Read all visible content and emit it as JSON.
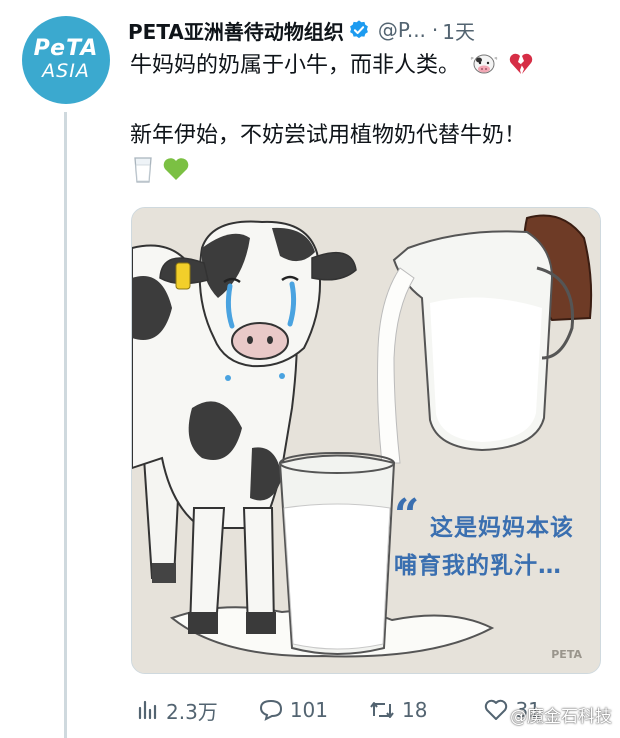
{
  "account": {
    "name": "PETA亚洲善待动物组织",
    "handle": "@P...",
    "separator": "·",
    "time": "1天",
    "avatar_line1": "PeTA",
    "avatar_line2": "ASIA"
  },
  "tweet": {
    "line1": "牛妈妈的奶属于小牛，而非人类。",
    "line2": "新年伊始，不妨尝试用植物奶代替牛奶！"
  },
  "media": {
    "quote_line1": "这是妈妈本该",
    "quote_line2": "哺育我的乳汁…",
    "quote_mark": "“",
    "brand_mark": "PETA"
  },
  "actions": {
    "views": "2.3万",
    "replies": "101",
    "retweets": "18",
    "likes": "31"
  },
  "watermark": "@魔金石科技",
  "colors": {
    "avatar": "#3ba9cf",
    "verified": "#1d9bf0",
    "muted": "#536471",
    "quote": "#3a6fb0"
  }
}
